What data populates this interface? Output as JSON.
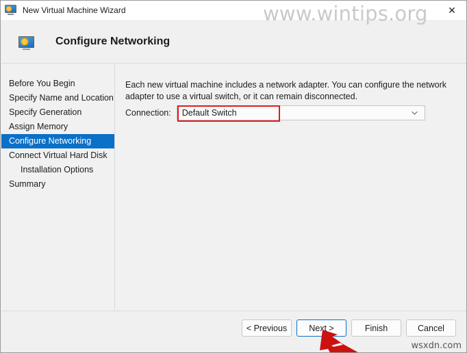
{
  "window": {
    "title": "New Virtual Machine Wizard",
    "title_icon": "virtual-machine-monitor-icon",
    "close_label": "✕"
  },
  "watermarks": {
    "top": "www.wintips.org",
    "bottom": "wsxdn.com"
  },
  "header": {
    "icon": "virtual-machine-monitor-icon",
    "title": "Configure Networking"
  },
  "nav": {
    "items": [
      {
        "label": "Before You Begin",
        "selected": false,
        "indented": false
      },
      {
        "label": "Specify Name and Location",
        "selected": false,
        "indented": false
      },
      {
        "label": "Specify Generation",
        "selected": false,
        "indented": false
      },
      {
        "label": "Assign Memory",
        "selected": false,
        "indented": false
      },
      {
        "label": "Configure Networking",
        "selected": true,
        "indented": false
      },
      {
        "label": "Connect Virtual Hard Disk",
        "selected": false,
        "indented": false
      },
      {
        "label": "Installation Options",
        "selected": false,
        "indented": true
      },
      {
        "label": "Summary",
        "selected": false,
        "indented": false
      }
    ]
  },
  "content": {
    "description": "Each new virtual machine includes a network adapter. You can configure the network adapter to use a virtual switch, or it can remain disconnected.",
    "connection_label": "Connection:",
    "connection_value": "Default Switch",
    "connection_chevron_icon": "chevron-down-icon",
    "highlight_color": "#e01b1b"
  },
  "footer": {
    "buttons": [
      {
        "label": "< Previous",
        "default": false
      },
      {
        "label": "Next >",
        "default": true
      },
      {
        "label": "Finish",
        "default": false
      },
      {
        "label": "Cancel",
        "default": false
      }
    ]
  },
  "annotation": {
    "arrow_icon": "red-pointer-arrow",
    "arrow_color": "#cc1111"
  },
  "colors": {
    "accent": "#0a70c8",
    "window_bg": "#f0f0f0",
    "body_bg": "#f1f1f1",
    "focus_border": "#0d6fc4"
  }
}
